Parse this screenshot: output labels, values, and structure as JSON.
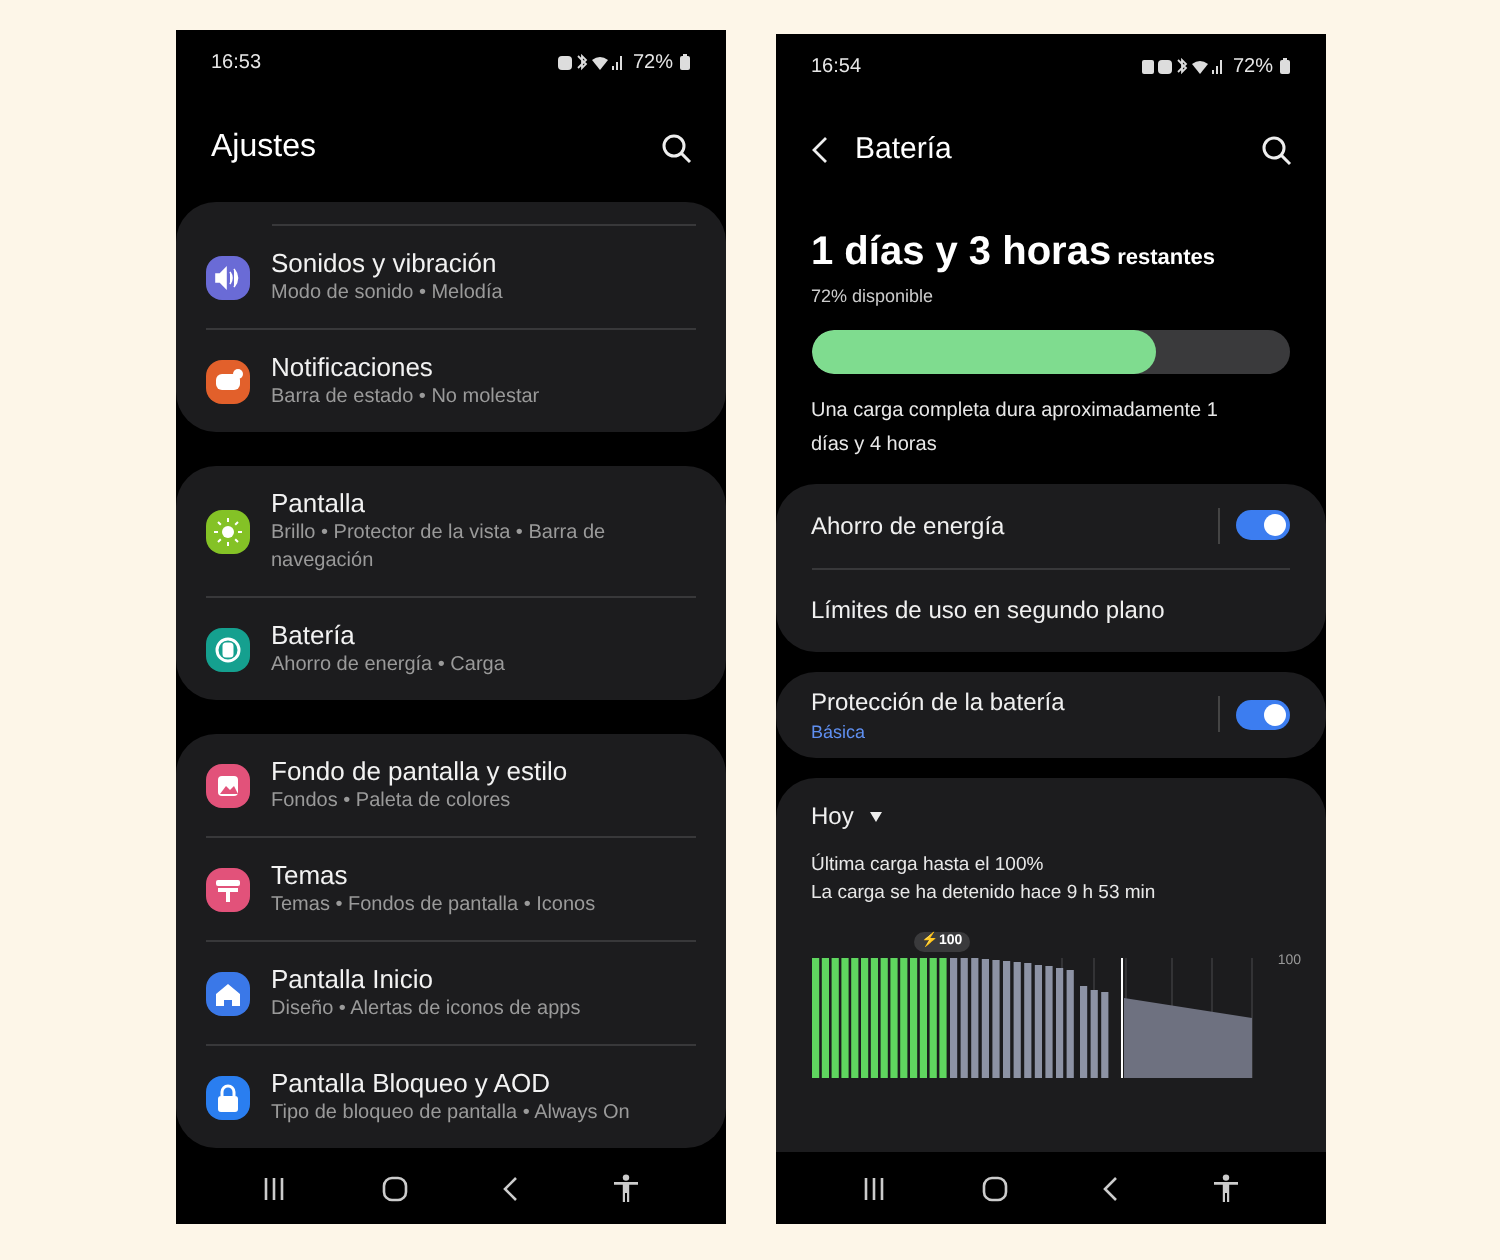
{
  "settings_screen": {
    "status_bar": {
      "time": "16:53",
      "battery": "72%"
    },
    "title": "Ajustes",
    "groups": [
      {
        "items": [
          {
            "title": "Sonidos y vibración",
            "subtitle": "Modo de sonido • Melodía",
            "color": "#6a6bd6"
          },
          {
            "title": "Notificaciones",
            "subtitle": "Barra de estado • No molestar",
            "color": "#e2602b"
          }
        ]
      },
      {
        "items": [
          {
            "title": "Pantalla",
            "subtitle": "Brillo • Protector de la vista • Barra de navegación",
            "color": "#84c226"
          },
          {
            "title": "Batería",
            "subtitle": "Ahorro de energía • Carga",
            "color": "#15a08f"
          }
        ]
      },
      {
        "items": [
          {
            "title": "Fondo de pantalla y estilo",
            "subtitle": "Fondos • Paleta de colores",
            "color": "#e2527a"
          },
          {
            "title": "Temas",
            "subtitle": "Temas • Fondos de pantalla • Iconos",
            "color": "#e2527a"
          },
          {
            "title": "Pantalla Inicio",
            "subtitle": "Diseño • Alertas de iconos de apps",
            "color": "#3a78e8"
          },
          {
            "title": "Pantalla Bloqueo y AOD",
            "subtitle": "Tipo de bloqueo de pantalla • Always On",
            "color": "#2a7ef0"
          }
        ]
      }
    ]
  },
  "battery_screen": {
    "status_bar": {
      "time": "16:54",
      "battery": "72%"
    },
    "title": "Batería",
    "remaining": {
      "value": "1 días y 3 horas",
      "unit": "restantes"
    },
    "available": "72% disponible",
    "level": 0.72,
    "full_charge_note": "Una carga completa dura aproximadamente 1 días y 4 horas",
    "cards": [
      {
        "rows": [
          {
            "label": "Ahorro de energía",
            "kind": "toggle",
            "on": true
          },
          {
            "label": "Límites de uso en segundo plano",
            "kind": "link"
          }
        ]
      },
      {
        "rows": [
          {
            "label": "Protección de la batería",
            "sublabel": "Básica",
            "kind": "toggle",
            "on": true
          }
        ]
      }
    ],
    "usage": {
      "period": "Hoy",
      "last_charge": "Última carga hasta el 100%",
      "stopped": "La carga se ha detenido hace 9 h 53 min",
      "peak_badge": "⚡100",
      "axis_label": "100"
    }
  }
}
